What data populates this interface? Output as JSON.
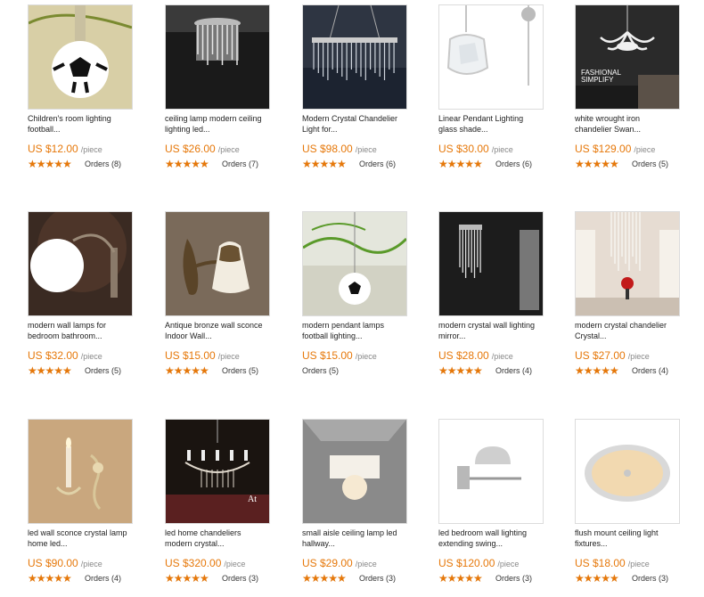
{
  "products": [
    {
      "title1": "Children's room lighting",
      "title2": "football...",
      "price": "US $12.00",
      "unit": "/piece",
      "rating": 5.0,
      "orders": "Orders (8)",
      "image": "football-ceiling-lamp-photo",
      "colors": {
        "bg": "#d8cfa6",
        "accent": "#7a8a30"
      }
    },
    {
      "title1": "ceiling lamp modern ceiling",
      "title2": "lighting led...",
      "price": "US $26.00",
      "unit": "/piece",
      "rating": 5.0,
      "orders": "Orders (7)",
      "image": "crystal-ceiling-lamp-photo",
      "colors": {
        "bg": "#1a1a1a",
        "accent": "#e8e8e8"
      }
    },
    {
      "title1": "Modern Crystal Chandelier",
      "title2": "Light for...",
      "price": "US $98.00",
      "unit": "/piece",
      "rating": 4.5,
      "orders": "Orders (6)",
      "image": "crystal-chandelier-photo",
      "colors": {
        "bg": "#2e3542",
        "accent": "#d0d6de"
      }
    },
    {
      "title1": "Linear Pendant Lighting",
      "title2": "glass shade...",
      "price": "US $30.00",
      "unit": "/piece",
      "rating": 5.0,
      "orders": "Orders (6)",
      "image": "glass-pendant-photo",
      "colors": {
        "bg": "#ffffff",
        "accent": "#c8c8c8"
      }
    },
    {
      "title1": "white wrought iron",
      "title2": "chandelier Swan...",
      "price": "US $129.00",
      "unit": "/piece",
      "rating": 5.0,
      "orders": "Orders (5)",
      "image": "swan-chandelier-photo",
      "colors": {
        "bg": "#2a2a2a",
        "accent": "#f0f0f0"
      },
      "overlay": [
        "FASHIONAL",
        "SIMPLIFY"
      ]
    },
    {
      "title1": "modern wall lamps for",
      "title2": "bedroom bathroom...",
      "price": "US $32.00",
      "unit": "/piece",
      "rating": 5.0,
      "orders": "Orders (5)",
      "image": "wall-globe-lamp-photo",
      "colors": {
        "bg": "#3a2a22",
        "accent": "#ffffff"
      }
    },
    {
      "title1": "Antique bronze wall sconce",
      "title2": "Indoor Wall...",
      "price": "US $15.00",
      "unit": "/piece",
      "rating": 4.5,
      "orders": "Orders (5)",
      "image": "bronze-sconce-photo",
      "colors": {
        "bg": "#7a6a5a",
        "accent": "#f2ece0"
      }
    },
    {
      "title1": "modern pendant lamps",
      "title2": "football lighting...",
      "price": "US $15.00",
      "unit": "/piece",
      "rating": 0,
      "orders": "Orders (5)",
      "image": "football-pendant-photo",
      "colors": {
        "bg": "#e4e6dc",
        "accent": "#5a9a2a"
      }
    },
    {
      "title1": "modern crystal wall lighting",
      "title2": "mirror...",
      "price": "US $28.00",
      "unit": "/piece",
      "rating": 5.0,
      "orders": "Orders (4)",
      "image": "crystal-wall-light-photo",
      "colors": {
        "bg": "#1c1c1c",
        "accent": "#e0e0e0"
      }
    },
    {
      "title1": "modern crystal chandelier",
      "title2": "Crystal...",
      "price": "US $27.00",
      "unit": "/piece",
      "rating": 5.0,
      "orders": "Orders (4)",
      "image": "hanging-crystal-photo",
      "colors": {
        "bg": "#e6dcd2",
        "accent": "#c21a1a"
      }
    },
    {
      "title1": "led wall sconce crystal lamp",
      "title2": "home led...",
      "price": "US $90.00",
      "unit": "/piece",
      "rating": 5.0,
      "orders": "Orders (4)",
      "image": "candle-sconce-photo",
      "colors": {
        "bg": "#c9a77e",
        "accent": "#fff6d8"
      }
    },
    {
      "title1": "led home chandeliers",
      "title2": "modern crystal...",
      "price": "US $320.00",
      "unit": "/piece",
      "rating": 5.0,
      "orders": "Orders (3)",
      "image": "candle-chandelier-photo",
      "colors": {
        "bg": "#1a1410",
        "accent": "#e0d8cc"
      },
      "overlay": [
        "At"
      ]
    },
    {
      "title1": "small aisle ceiling lamp led",
      "title2": "hallway...",
      "price": "US $29.00",
      "unit": "/piece",
      "rating": 5.0,
      "orders": "Orders (3)",
      "image": "aisle-ceiling-lamp-photo",
      "colors": {
        "bg": "#8a8a8a",
        "accent": "#f4f0e8"
      }
    },
    {
      "title1": "led bedroom wall lighting",
      "title2": "extending swing...",
      "price": "US $120.00",
      "unit": "/piece",
      "rating": 5.0,
      "orders": "Orders (3)",
      "image": "swing-arm-lamp-photo",
      "colors": {
        "bg": "#ffffff",
        "accent": "#b8b8b8"
      }
    },
    {
      "title1": "flush mount ceiling light",
      "title2": "fixtures...",
      "price": "US $18.00",
      "unit": "/piece",
      "rating": 5.0,
      "orders": "Orders (3)",
      "image": "flush-mount-photo",
      "colors": {
        "bg": "#ffffff",
        "accent": "#f2d9b0"
      }
    }
  ]
}
